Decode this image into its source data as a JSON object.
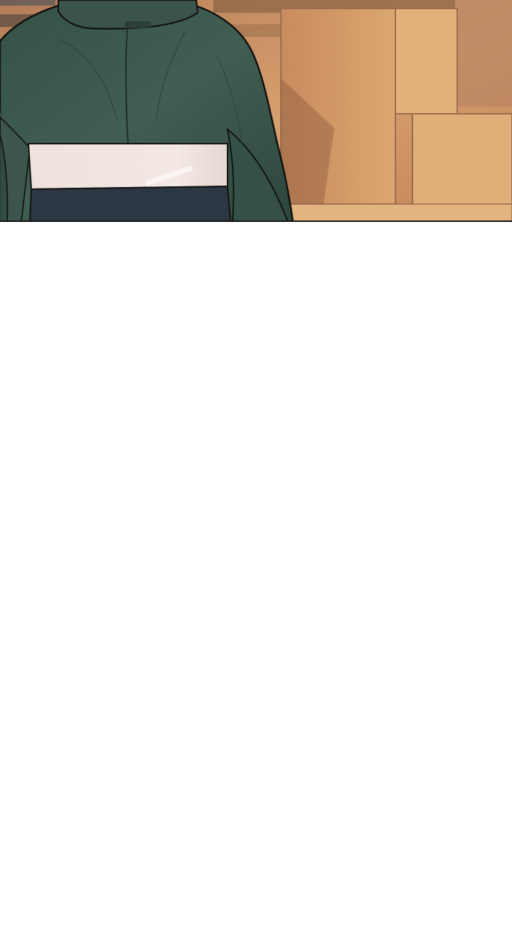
{
  "comic": {
    "panel": {
      "scene": "figure-back-indoors",
      "palette": {
        "wall": "#d39a6a",
        "wall_light": "#e4b582",
        "wall_shadow": "#a36f4d",
        "jacket": "#3f5a4f",
        "jacket_shadow": "#2f4a40",
        "stripe_light": "#f0e3de",
        "stripe_dark": "#2d3743",
        "outline": "#151515"
      }
    },
    "blank_area": {
      "color": "#ffffff"
    }
  }
}
